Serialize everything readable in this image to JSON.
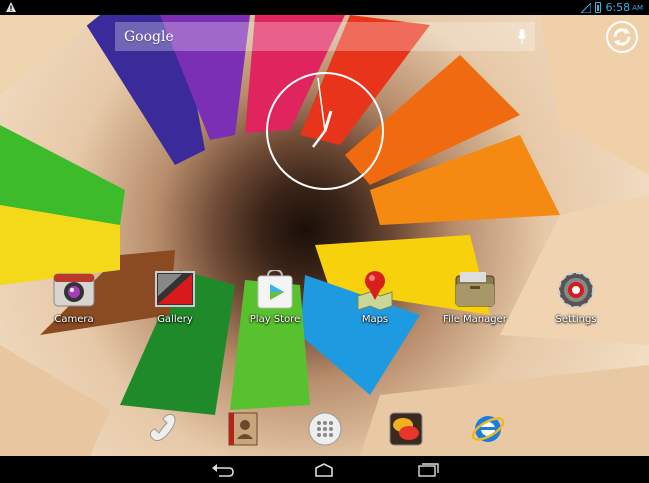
{
  "status_bar": {
    "time": "6:58",
    "ampm": "AM"
  },
  "search": {
    "label": "Google"
  },
  "apps": [
    {
      "label": "Camera",
      "icon": "camera-icon"
    },
    {
      "label": "Gallery",
      "icon": "gallery-icon"
    },
    {
      "label": "Play Store",
      "icon": "play-store-icon"
    },
    {
      "label": "Maps",
      "icon": "maps-icon"
    },
    {
      "label": "File Manager",
      "icon": "file-manager-icon"
    },
    {
      "label": "Settings",
      "icon": "settings-icon"
    }
  ],
  "dock": [
    "phone-icon",
    "contacts-icon",
    "app-drawer-icon",
    "messaging-icon",
    "browser-icon"
  ],
  "nav": [
    "back-icon",
    "home-icon",
    "recent-apps-icon"
  ],
  "colors": {
    "status_accent": "#33b5e5",
    "text": "#ffffff"
  }
}
